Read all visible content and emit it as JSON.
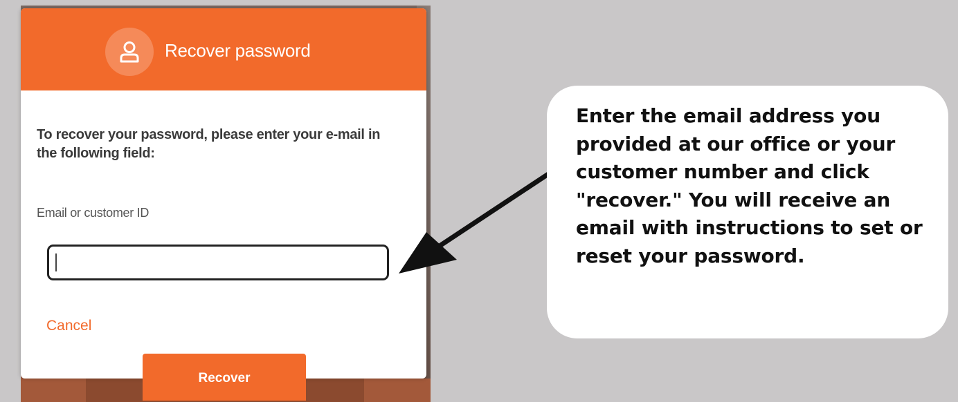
{
  "modal": {
    "title": "Recover password",
    "instructions": "To recover your password, please enter your e-mail in the following field:",
    "field_label": "Email or customer ID",
    "field_value": "",
    "cancel_label": "Cancel",
    "recover_label": "Recover",
    "header_icon": "user-icon"
  },
  "callout": {
    "text": "Enter the email address you provided at our office or your customer number and click \"recover.\" You will receive an email with instructions to set or reset your password."
  },
  "colors": {
    "accent": "#f26a2b",
    "background": "#c9c7c8",
    "text_dark": "#3a3a3a"
  }
}
